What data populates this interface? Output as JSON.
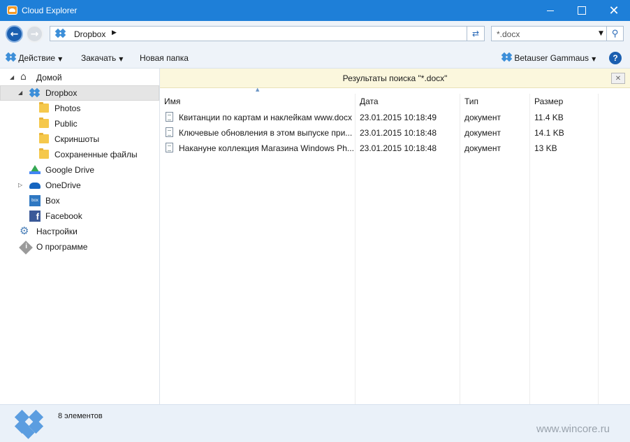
{
  "window": {
    "title": "Cloud Explorer",
    "close_glyph": "✕"
  },
  "nav": {
    "back_glyph": "←",
    "forward_glyph": "→",
    "address": "Dropbox",
    "address_arrow": "▶",
    "refresh_glyph": "⇄",
    "search_value": "*.docx",
    "search_drop": "▼",
    "search_glyph": "⚲"
  },
  "toolbar": {
    "action_label": "Действие",
    "download_label": "Закачать",
    "new_folder_label": "Новая папка",
    "account_label": "Betauser Gammaus",
    "caret": "▼",
    "help_label": "?"
  },
  "sidebar": {
    "items": [
      {
        "label": "Домой",
        "expander": "◢"
      },
      {
        "label": "Dropbox",
        "expander": "◢"
      },
      {
        "label": "Photos"
      },
      {
        "label": "Public"
      },
      {
        "label": "Скриншоты"
      },
      {
        "label": "Сохраненные файлы"
      },
      {
        "label": "Google Drive"
      },
      {
        "label": "OneDrive",
        "expander": "▷"
      },
      {
        "label": "Box"
      },
      {
        "label": "Facebook"
      },
      {
        "label": "Настройки"
      },
      {
        "label": "О программе"
      }
    ]
  },
  "search_banner": {
    "text": "Результаты поиска \"*.docx\"",
    "close_glyph": "✕"
  },
  "table": {
    "columns": [
      "Имя",
      "Дата",
      "Тип",
      "Размер"
    ],
    "sort_glyph": "▲",
    "rows": [
      {
        "name": "Квитанции по картам и наклейкам www.docx",
        "date": "23.01.2015 10:18:49",
        "type": "документ",
        "size": "11.4 KB"
      },
      {
        "name": "Ключевые обновления в этом выпуске при...",
        "date": "23.01.2015 10:18:48",
        "type": "документ",
        "size": "14.1 KB"
      },
      {
        "name": "Накануне коллекция Магазина Windows Ph...",
        "date": "23.01.2015 10:18:48",
        "type": "документ",
        "size": "13 KB"
      }
    ]
  },
  "status": {
    "count_text": "8 элементов",
    "watermark": "www.wincore.ru"
  },
  "icons": {
    "home": "⌂",
    "settings": "⚙",
    "box_text": "box",
    "facebook_text": "f"
  },
  "colors": {
    "titlebar": "#1e7fd8",
    "accent": "#1b5fb0",
    "banner": "#fbf7dd"
  }
}
